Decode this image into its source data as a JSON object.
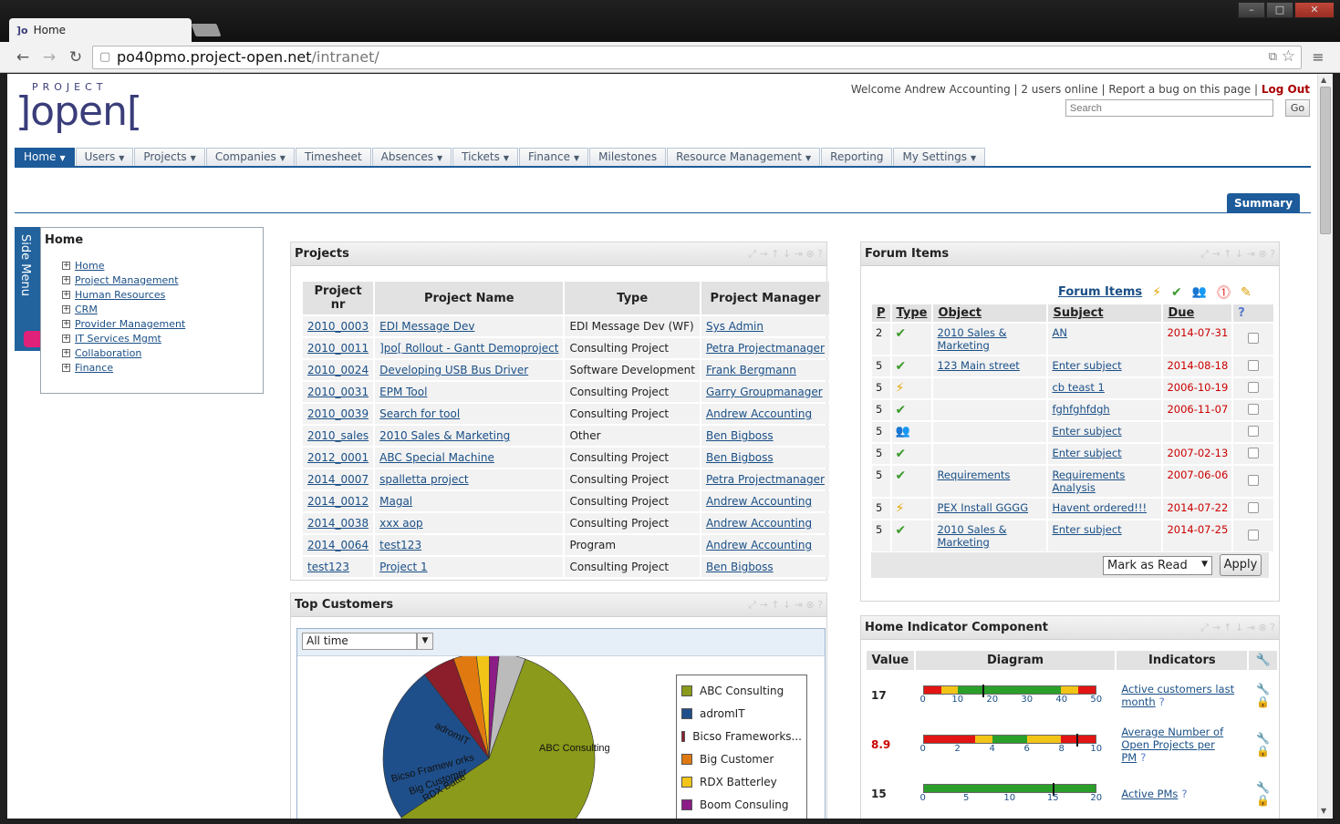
{
  "browser": {
    "tab_title": "Home",
    "url_host": "po40pmo.project-open.net",
    "url_path": "/intranet/",
    "window_buttons": [
      "–",
      "□",
      "✕"
    ]
  },
  "header": {
    "logo_top": "PROJECT",
    "logo_main": "]open[",
    "welcome": "Welcome Andrew Accounting",
    "users_online": "2 users online",
    "report_bug": "Report a bug on this page",
    "logout": "Log Out",
    "search_placeholder": "Search",
    "go": "Go"
  },
  "nav": {
    "tabs": [
      {
        "label": "Home",
        "dropdown": true
      },
      {
        "label": "Users",
        "dropdown": true
      },
      {
        "label": "Projects",
        "dropdown": true
      },
      {
        "label": "Companies",
        "dropdown": true
      },
      {
        "label": "Timesheet",
        "dropdown": false
      },
      {
        "label": "Absences",
        "dropdown": true
      },
      {
        "label": "Tickets",
        "dropdown": true
      },
      {
        "label": "Finance",
        "dropdown": true
      },
      {
        "label": "Milestones",
        "dropdown": false
      },
      {
        "label": "Resource Management",
        "dropdown": true
      },
      {
        "label": "Reporting",
        "dropdown": false
      },
      {
        "label": "My Settings",
        "dropdown": true
      }
    ],
    "subtab": "Summary"
  },
  "sidemenu": {
    "tab_label": "Side Menu",
    "title": "Home",
    "items": [
      "Home",
      "Project Management",
      "Human Resources",
      "CRM",
      "Provider Management",
      "IT Services Mgmt",
      "Collaboration",
      "Finance"
    ]
  },
  "projects": {
    "title": "Projects",
    "headers": [
      "Project nr",
      "Project Name",
      "Type",
      "Project Manager"
    ],
    "rows": [
      [
        "2010_0003",
        "EDI Message Dev",
        "EDI Message Dev (WF)",
        "Sys Admin"
      ],
      [
        "2010_0011",
        "]po[ Rollout - Gantt Demoproject",
        "Consulting Project",
        "Petra Projectmanager"
      ],
      [
        "2010_0024",
        "Developing USB Bus Driver",
        "Software Development",
        "Frank Bergmann"
      ],
      [
        "2010_0031",
        "EPM Tool",
        "Consulting Project",
        "Garry Groupmanager"
      ],
      [
        "2010_0039",
        "Search for tool",
        "Consulting Project",
        "Andrew Accounting"
      ],
      [
        "2010_sales",
        "2010 Sales & Marketing",
        "Other",
        "Ben Bigboss"
      ],
      [
        "2012_0001",
        "ABC Special Machine",
        "Consulting Project",
        "Ben Bigboss"
      ],
      [
        "2014_0007",
        "spalletta project",
        "Consulting Project",
        "Petra Projectmanager"
      ],
      [
        "2014_0012",
        "Magal",
        "Consulting Project",
        "Andrew Accounting"
      ],
      [
        "2014_0038",
        "xxx aop",
        "Consulting Project",
        "Andrew Accounting"
      ],
      [
        "2014_0064",
        "test123",
        "Program",
        "Andrew Accounting"
      ],
      [
        "test123",
        "Project 1",
        "Consulting Project",
        "Ben Bigboss"
      ]
    ]
  },
  "forum": {
    "title": "Forum Items",
    "link": "Forum Items",
    "headers": [
      "P",
      "Type",
      "Object",
      "Subject",
      "Due"
    ],
    "rows": [
      {
        "p": "2",
        "type": "check",
        "object": "2010 Sales & Marketing",
        "subject": "AN",
        "due": "2014-07-31"
      },
      {
        "p": "5",
        "type": "check",
        "object": "123 Main street",
        "subject": "Enter subject",
        "due": "2014-08-18"
      },
      {
        "p": "5",
        "type": "bolt",
        "object": "",
        "subject": "cb teast 1",
        "due": "2006-10-19"
      },
      {
        "p": "5",
        "type": "check",
        "object": "",
        "subject": "fghfghfdgh",
        "due": "2006-11-07"
      },
      {
        "p": "5",
        "type": "people",
        "object": "",
        "subject": "Enter subject",
        "due": ""
      },
      {
        "p": "5",
        "type": "check",
        "object": "",
        "subject": "Enter subject",
        "due": "2007-02-13"
      },
      {
        "p": "5",
        "type": "check",
        "object": "Requirements",
        "subject": "Requirements Analysis",
        "due": "2007-06-06"
      },
      {
        "p": "5",
        "type": "bolt",
        "object": "PEX Install GGGG",
        "subject": "Havent ordered!!!",
        "due": "2014-07-22"
      },
      {
        "p": "5",
        "type": "check",
        "object": "2010 Sales & Marketing",
        "subject": "Enter subject",
        "due": "2014-07-25"
      }
    ],
    "action_select": "Mark as Read",
    "apply": "Apply"
  },
  "customers": {
    "title": "Top Customers",
    "period": "All time"
  },
  "chart_data": {
    "type": "pie",
    "title": "",
    "series": [
      {
        "name": "ABC Consulting",
        "value": 60,
        "color": "#8b9a1a"
      },
      {
        "name": "adromIT",
        "value": 24,
        "color": "#1f4f8a"
      },
      {
        "name": "Bicso Frameworks...",
        "value": 5,
        "color": "#8b1e2a"
      },
      {
        "name": "Big Customer",
        "value": 3.5,
        "color": "#e07a10"
      },
      {
        "name": "RDX Batterley",
        "value": 2,
        "color": "#f2c418"
      },
      {
        "name": "Boom Consuling",
        "value": 1.5,
        "color": "#8a1e86"
      },
      {
        "name": "",
        "value": 4,
        "color": "#bbbbbb"
      }
    ],
    "slice_labels": [
      "ABC Consulting",
      "adromIT",
      "Bicso Framew orks",
      "Big Customer",
      "RDX Batte"
    ]
  },
  "indicators": {
    "title": "Home Indicator Component",
    "headers": [
      "Value",
      "Diagram",
      "Indicators"
    ],
    "rows": [
      {
        "value": "17",
        "value_color": "#222",
        "ticks": [
          "0",
          "10",
          "20",
          "30",
          "40",
          "50"
        ],
        "max": 50,
        "marker": 17,
        "bands": [
          {
            "c": "#e31414",
            "w": 0.1
          },
          {
            "c": "#f2c418",
            "w": 0.1
          },
          {
            "c": "#2aa02a",
            "w": 0.6
          },
          {
            "c": "#f2c418",
            "w": 0.1
          },
          {
            "c": "#e31414",
            "w": 0.1
          }
        ],
        "label": "Active customers last month"
      },
      {
        "value": "8.9",
        "value_color": "#c00",
        "ticks": [
          "0",
          "2",
          "4",
          "6",
          "8",
          "10"
        ],
        "max": 10,
        "marker": 8.9,
        "bands": [
          {
            "c": "#e31414",
            "w": 0.3
          },
          {
            "c": "#f2c418",
            "w": 0.1
          },
          {
            "c": "#2aa02a",
            "w": 0.2
          },
          {
            "c": "#f2c418",
            "w": 0.2
          },
          {
            "c": "#e31414",
            "w": 0.2
          }
        ],
        "label": "Average Number of Open Projects per PM"
      },
      {
        "value": "15",
        "value_color": "#222",
        "ticks": [
          "0",
          "5",
          "10",
          "15",
          "20"
        ],
        "max": 20,
        "marker": 15,
        "bands": [
          {
            "c": "#2aa02a",
            "w": 1.0
          }
        ],
        "label": "Active PMs"
      }
    ]
  }
}
